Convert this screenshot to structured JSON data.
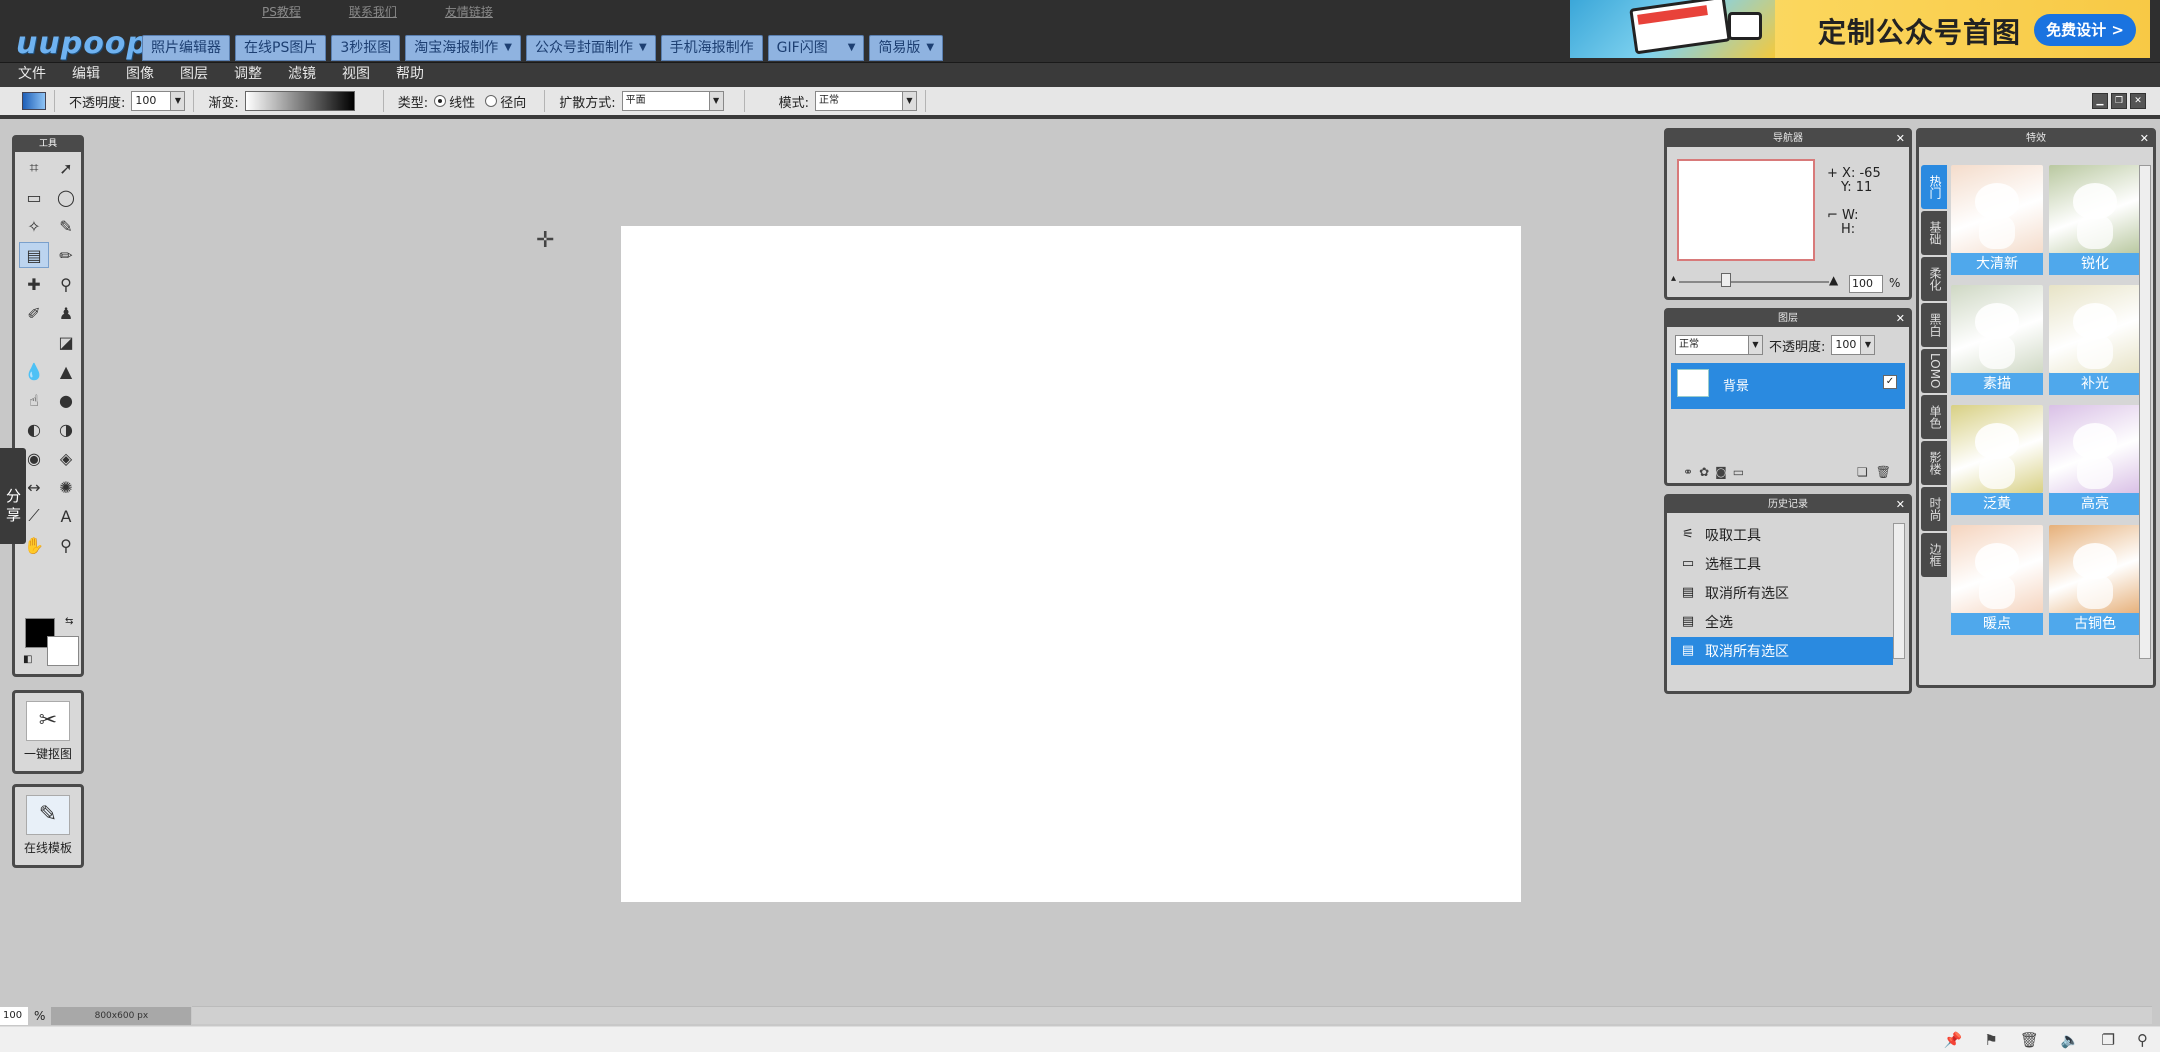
{
  "header": {
    "logo": "uupoop",
    "top_links": [
      "PS教程",
      "联系我们",
      "友情链接"
    ],
    "nav_tabs": [
      {
        "label": "照片编辑器",
        "dropdown": false
      },
      {
        "label": "在线PS图片",
        "dropdown": false
      },
      {
        "label": "3秒抠图",
        "dropdown": false
      },
      {
        "label": "淘宝海报制作",
        "dropdown": true
      },
      {
        "label": "公众号封面制作",
        "dropdown": true
      },
      {
        "label": "手机海报制作",
        "dropdown": false
      },
      {
        "label": "GIF闪图",
        "dropdown": true
      },
      {
        "label": "简易版",
        "dropdown": true
      }
    ],
    "ad": {
      "title": "定制公众号首图",
      "button": "免费设计 >",
      "colors": {
        "background": "#f8d454",
        "button": "#1a73e0"
      }
    }
  },
  "menu": [
    "文件",
    "编辑",
    "图像",
    "图层",
    "调整",
    "滤镜",
    "视图",
    "帮助"
  ],
  "options": {
    "opacity_label": "不透明度:",
    "opacity_value": "100",
    "gradient_label": "渐变:",
    "type_label": "类型:",
    "type_linear": "线性",
    "type_radial": "径向",
    "spread_label": "扩散方式:",
    "spread_value": "平面",
    "mode_label": "模式:",
    "mode_value": "正常"
  },
  "toolbox": {
    "title": "工具",
    "tools": [
      {
        "name": "crop-icon",
        "glyph": "⌗"
      },
      {
        "name": "move-icon",
        "glyph": "➚"
      },
      {
        "name": "marquee-icon",
        "glyph": "▭"
      },
      {
        "name": "lasso-icon",
        "glyph": "◯"
      },
      {
        "name": "magic-wand-icon",
        "glyph": "✧"
      },
      {
        "name": "eraser-icon",
        "glyph": "✎"
      },
      {
        "name": "gradient-icon",
        "glyph": "▤"
      },
      {
        "name": "brush-icon",
        "glyph": "✏"
      },
      {
        "name": "heal-icon",
        "glyph": "✚"
      },
      {
        "name": "clone-icon",
        "glyph": "⚲"
      },
      {
        "name": "pencil-icon",
        "glyph": "✐"
      },
      {
        "name": "stamp-icon",
        "glyph": "♟"
      },
      {
        "name": "blank-slot",
        "glyph": ""
      },
      {
        "name": "fill-icon",
        "glyph": "◪"
      },
      {
        "name": "blur-icon",
        "glyph": "💧"
      },
      {
        "name": "sharpen-icon",
        "glyph": "▲"
      },
      {
        "name": "smudge-icon",
        "glyph": "☝"
      },
      {
        "name": "sponge-icon",
        "glyph": "●"
      },
      {
        "name": "dodge-icon",
        "glyph": "◐"
      },
      {
        "name": "burn-icon",
        "glyph": "◑"
      },
      {
        "name": "redeye-icon",
        "glyph": "◉"
      },
      {
        "name": "patch-icon",
        "glyph": "◈"
      },
      {
        "name": "liquify-icon",
        "glyph": "↔"
      },
      {
        "name": "bloat-icon",
        "glyph": "✺"
      },
      {
        "name": "picker-icon",
        "glyph": "⟋"
      },
      {
        "name": "text-icon",
        "glyph": "A"
      },
      {
        "name": "hand-icon",
        "glyph": "✋"
      },
      {
        "name": "zoom-icon",
        "glyph": "⚲"
      }
    ]
  },
  "share": "分享",
  "quick": [
    {
      "label": "一键抠图",
      "icon": "✂"
    },
    {
      "label": "在线模板",
      "icon": "✎"
    }
  ],
  "navigator": {
    "title": "导航器",
    "x_label": "X:",
    "x_value": "-65",
    "y_label": "Y:",
    "y_value": "11",
    "w_label": "W:",
    "h_label": "H:",
    "zoom": "100",
    "zoom_unit": "%"
  },
  "layers": {
    "title": "图层",
    "blend": "正常",
    "opacity_label": "不透明度:",
    "opacity_value": "100",
    "layer_name": "背景"
  },
  "history": {
    "title": "历史记录",
    "items": [
      {
        "label": "吸取工具",
        "icon": "⚟"
      },
      {
        "label": "选框工具",
        "icon": "▭"
      },
      {
        "label": "取消所有选区",
        "icon": "▤"
      },
      {
        "label": "全选",
        "icon": "▤"
      },
      {
        "label": "取消所有选区",
        "icon": "▤"
      }
    ],
    "selected_index": 4
  },
  "effects": {
    "title": "特效",
    "tabs": [
      "热门",
      "基础",
      "柔化",
      "黑白",
      "LOMO",
      "单色",
      "影楼",
      "时尚",
      "边框"
    ],
    "selected_tab": 0,
    "items": [
      {
        "label": "大清新",
        "color": "#f4dccb"
      },
      {
        "label": "锐化",
        "color": "#b9c8a0"
      },
      {
        "label": "素描",
        "color": "#cfd8c4"
      },
      {
        "label": "补光",
        "color": "#e7e3c6"
      },
      {
        "label": "泛黄",
        "color": "#d8d084"
      },
      {
        "label": "高亮",
        "color": "#d9c0e6"
      },
      {
        "label": "暖点",
        "color": "#f5d4be"
      },
      {
        "label": "古铜色",
        "color": "#e6b07a"
      }
    ]
  },
  "status": {
    "zoom": "100",
    "zoom_unit": "%",
    "size": "800x600 px"
  },
  "taskbar_icons": [
    "pin-icon",
    "flag-icon",
    "trash-icon",
    "sound-icon",
    "window-icon",
    "search-icon"
  ]
}
